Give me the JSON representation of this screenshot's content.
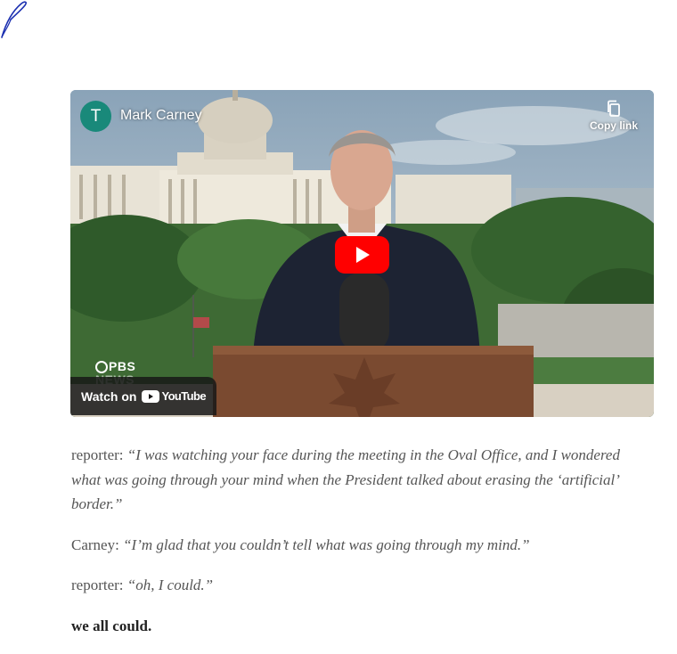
{
  "site": {
    "logo_icon": "quill-feather-icon"
  },
  "video": {
    "channel_initial": "T",
    "channel_title": "Mark Carney",
    "copy_link_label": "Copy link",
    "watch_on_label": "Watch on",
    "youtube_wordmark": "YouTube",
    "broadcaster_logo_text": "PBS",
    "broadcaster_logo_sub": "NEWS",
    "play_color": "#ff0000",
    "avatar_color": "#19897a"
  },
  "article": {
    "paragraphs": [
      {
        "speaker": "reporter:",
        "quote": "“I was watching your face during the meeting in the Oval Office, and I wondered what was going through your mind when the President talked about erasing the ‘artificial’ border.”"
      },
      {
        "speaker": "Carney:",
        "quote": "“I’m glad that you couldn’t tell what was going through my mind.”"
      },
      {
        "speaker": "reporter:",
        "quote": "“oh, I could.”"
      }
    ],
    "closing": "we all could."
  }
}
